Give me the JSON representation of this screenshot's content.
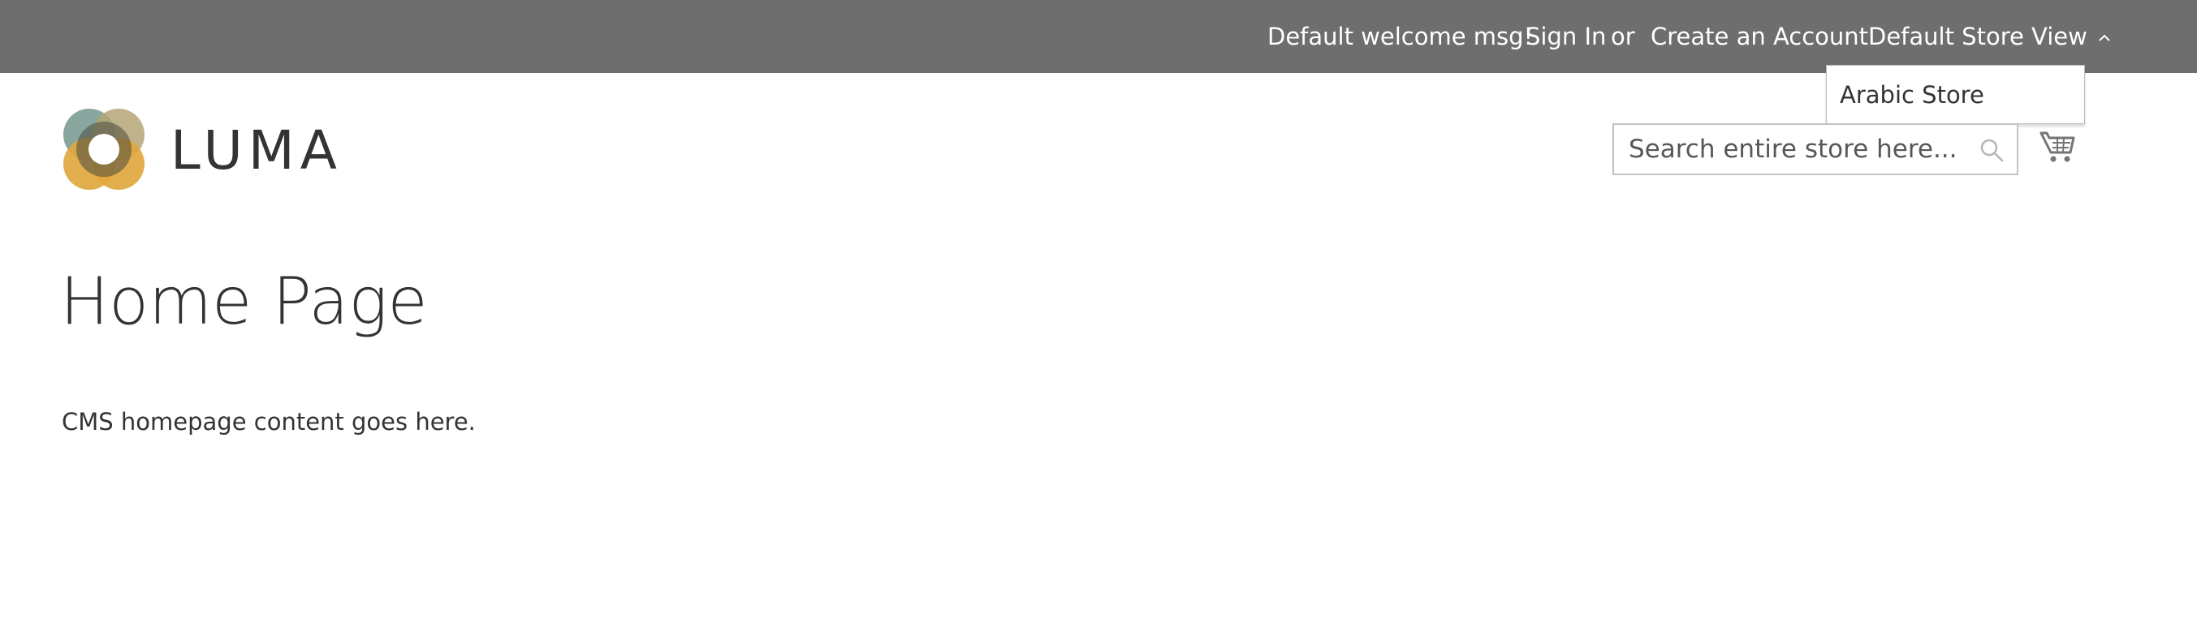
{
  "panel": {
    "welcome": "Default welcome msg!",
    "sign_in": "Sign In",
    "or": "or",
    "create_account": "Create an Account",
    "store_switcher": "Default Store View",
    "switcher_icon": "chevron-up-icon",
    "dropdown_options": [
      "Arabic Store"
    ]
  },
  "header": {
    "logo_text": "LUMA",
    "search_placeholder": "Search entire store here...",
    "search_value": "",
    "search_icon": "search-icon",
    "cart_icon": "cart-icon"
  },
  "main": {
    "page_title": "Home Page",
    "content": "CMS homepage content goes here."
  },
  "colors": {
    "panel_bg": "#6e6e6e",
    "panel_text": "#ffffff",
    "text": "#333333",
    "logo_teal": "#7c9c93",
    "logo_gold": "#e0a63b",
    "logo_olive": "#b5a576"
  }
}
